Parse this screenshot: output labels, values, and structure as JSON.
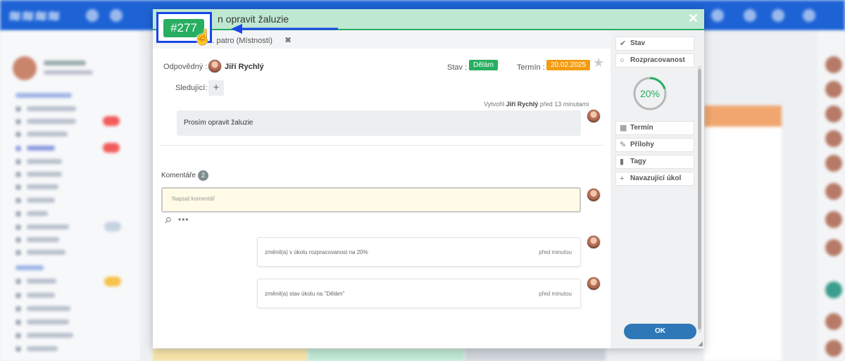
{
  "modal": {
    "title": "n opravit žaluzie",
    "location": "o, 2. patro (Místnosti)",
    "close": "✕",
    "task_number": "#277"
  },
  "fields": {
    "responsible_label": "Odpovědný :",
    "responsible_name": "Jiří Rychlý",
    "followers_label": "Sledující:",
    "followers_add": "+",
    "state_label": "Stav :",
    "state_value": "Dělám",
    "deadline_label": "Termín :",
    "deadline_value": "20.02.2025",
    "star": "★"
  },
  "description": {
    "created_prefix": "Vytvořil",
    "created_author": "Jiří Rychlý",
    "created_suffix": "před 13 minutami",
    "text": "Prosím opravit žaluzie"
  },
  "comments": {
    "label": "Komentáře",
    "count": "2",
    "placeholder": "Napsat komentář",
    "more": "•••",
    "clip": "🖇"
  },
  "activity": [
    {
      "text": "změnil(a) v úkolu rozpracovanost na 20%",
      "time": "před minutou"
    },
    {
      "text": "změnil(a) stav úkolu na \"Dělám\"",
      "time": "před minutou"
    }
  ],
  "side": {
    "stav": "Stav",
    "rozpracovanost": "Rozpracovanost",
    "progress_text": "20%",
    "progress_value": 0.2,
    "termin": "Termín",
    "prilohy": "Přílohy",
    "tagy": "Tagy",
    "navazujici": "Navazující úkol",
    "ok": "OK"
  },
  "colors": {
    "accent_green": "#27ae60",
    "deadline_orange": "#f39c12",
    "ok_blue": "#2e78b7",
    "annotation_blue": "#1946ea"
  },
  "icons": {
    "check": "✔",
    "circle": "○",
    "calendar": "▦",
    "paperclip": "✎",
    "bookmark": "▮",
    "plus": "+",
    "hand": "☝"
  }
}
